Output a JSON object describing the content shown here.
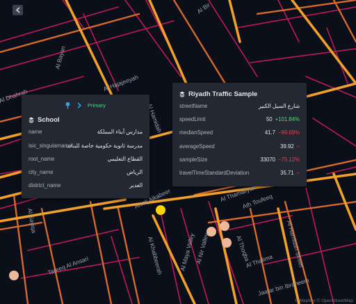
{
  "map": {
    "street_labels": [
      "Al Bir",
      "Al Bayan",
      "Al Hajajeeyah",
      "Al Hamidah",
      "Al Dhahrah",
      "Alsalj Alkabeer",
      "Al Thamaliyah",
      "Ath Toufeeq",
      "Al Hamidah Street",
      "Al Khabbeerah",
      "Al Maya Valley",
      "Al Nir Valley",
      "Al Thoqba",
      "Tareeq Al Ansari",
      "Al Thalima",
      "Jaafar bin Ibraheem",
      "Al Sayiqa"
    ],
    "attribution": "© Mapbox © OpenStreetMap",
    "colors": {
      "background": "#0b0f1a",
      "road_high": "#f1a02a",
      "road_mid": "#d66a2a",
      "road_low": "#c2185b",
      "selected_point": "#ffd400",
      "points": "#f0b89a"
    }
  },
  "school_card": {
    "title": "School",
    "title_icon": "layers-icon",
    "header_icons": [
      "pin-icon",
      "chevron-right-icon"
    ],
    "header_label": "Primary",
    "rows": [
      {
        "key": "name",
        "value": "مدارس أبناء المملكة"
      },
      {
        "key": "isic_singularname",
        "value": "مدرسة ثانوية حكومية خاصة للبنات"
      },
      {
        "key": "root_name",
        "value": "القطاع التعليمي"
      },
      {
        "key": "city_name",
        "value": "الرياض"
      },
      {
        "key": "district_name",
        "value": "الغدير"
      }
    ]
  },
  "traffic_card": {
    "title": "Riyadh Traffic Sample",
    "title_icon": "layers-icon",
    "rows": [
      {
        "key": "streetName",
        "value": "شارع السيل الكبير",
        "delta": ""
      },
      {
        "key": "speedLimit",
        "value": "50",
        "delta": "+101.84%",
        "delta_sign": "pos"
      },
      {
        "key": "medianSpeed",
        "value": "41.7",
        "delta": "−99.69%",
        "delta_sign": "neg"
      },
      {
        "key": "averageSpeed",
        "value": "39.92",
        "delta": "–",
        "delta_sign": "neg"
      },
      {
        "key": "sampleSize",
        "value": "33070",
        "delta": "−75.12%",
        "delta_sign": "neg"
      },
      {
        "key": "travelTimeStandardDeviation",
        "value": "35.71",
        "delta": "–",
        "delta_sign": "neg"
      }
    ]
  }
}
